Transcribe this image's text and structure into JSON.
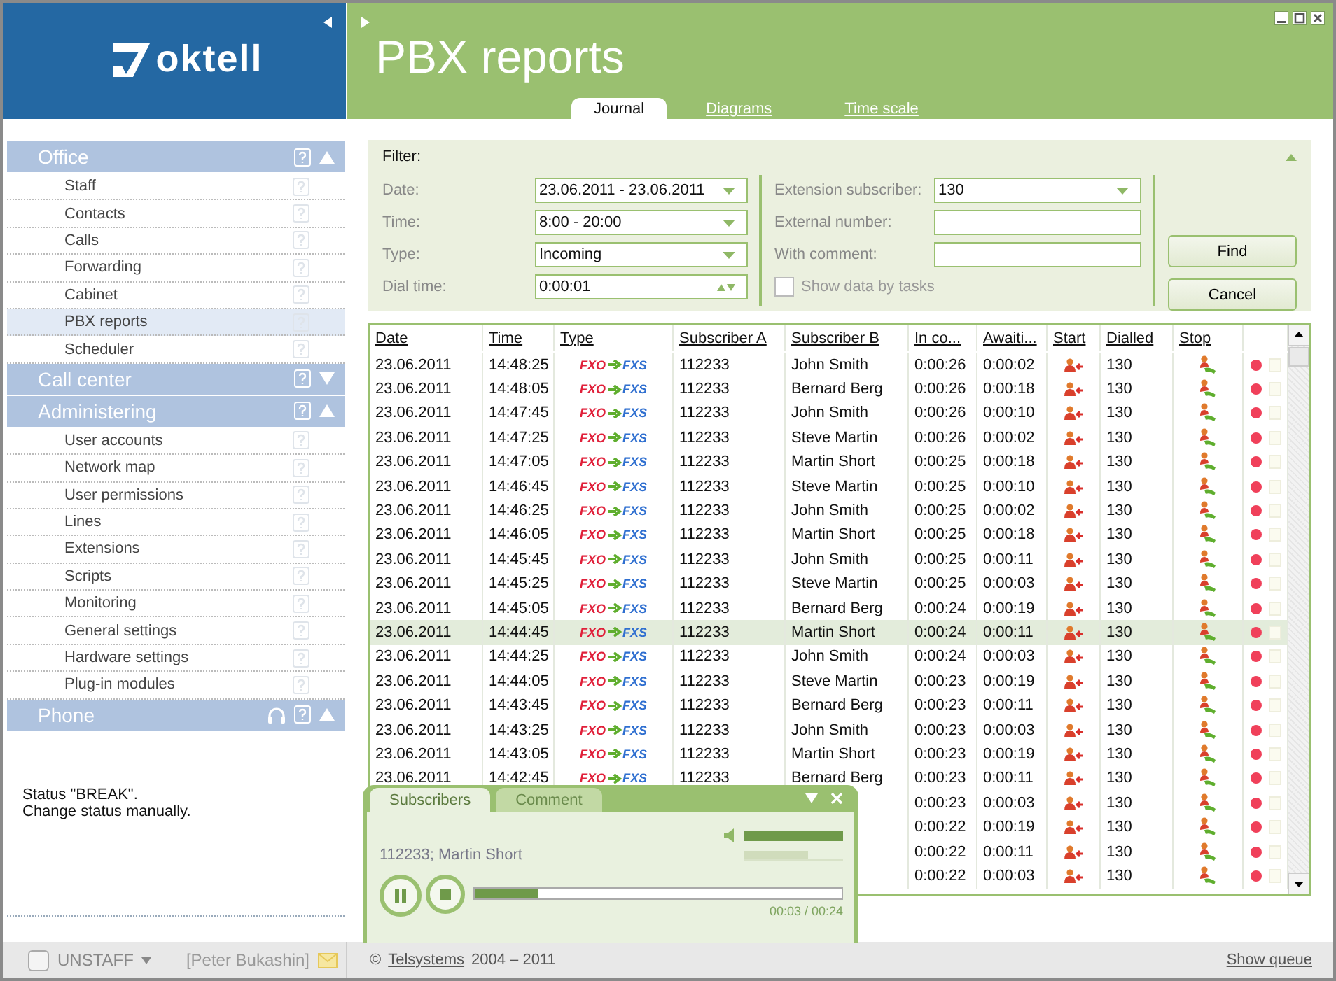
{
  "logo": {
    "text": "oktell"
  },
  "header": {
    "title": "PBX reports",
    "tabs": [
      {
        "label": "Journal",
        "selected": true
      },
      {
        "label": "Diagrams",
        "selected": false
      },
      {
        "label": "Time scale",
        "selected": false
      }
    ]
  },
  "sidebar": {
    "sections": [
      {
        "title": "Office",
        "expanded": true,
        "headset": false,
        "items": [
          {
            "label": "Staff",
            "selected": false
          },
          {
            "label": "Contacts",
            "selected": false
          },
          {
            "label": "Calls",
            "selected": false
          },
          {
            "label": "Forwarding",
            "selected": false
          },
          {
            "label": "Cabinet",
            "selected": false
          },
          {
            "label": "PBX reports",
            "selected": true
          },
          {
            "label": "Scheduler",
            "selected": false
          }
        ]
      },
      {
        "title": "Call center",
        "expanded": false,
        "headset": false
      },
      {
        "title": "Administering",
        "expanded": true,
        "headset": false,
        "items": [
          {
            "label": "User accounts",
            "selected": false
          },
          {
            "label": "Network map",
            "selected": false
          },
          {
            "label": "User permissions",
            "selected": false
          },
          {
            "label": "Lines",
            "selected": false
          },
          {
            "label": "Extensions",
            "selected": false
          },
          {
            "label": "Scripts",
            "selected": false
          },
          {
            "label": "Monitoring",
            "selected": false
          },
          {
            "label": "General settings",
            "selected": false
          },
          {
            "label": "Hardware settings",
            "selected": false
          },
          {
            "label": "Plug-in modules",
            "selected": false
          }
        ]
      },
      {
        "title": "Phone",
        "expanded": true,
        "headset": true
      }
    ]
  },
  "status_message": [
    "Status \"BREAK\".",
    "Change status manually."
  ],
  "status_bar": {
    "checked": false,
    "status": "UNSTAFF",
    "user": "[Peter Bukashin]"
  },
  "filter": {
    "title": "Filter:",
    "left": [
      {
        "label": "Date:",
        "kind": "dropdown",
        "value": "23.06.2011 - 23.06.2011"
      },
      {
        "label": "Time:",
        "kind": "dropdown",
        "value": "8:00 - 20:00"
      },
      {
        "label": "Type:",
        "kind": "dropdown",
        "value": "Incoming"
      },
      {
        "label": "Dial time:",
        "kind": "spinner",
        "value": "0:00:01"
      }
    ],
    "right": [
      {
        "label": "Extension subscriber:",
        "kind": "dropdown",
        "value": "130"
      },
      {
        "label": "External number:",
        "kind": "text"
      },
      {
        "label": "With comment:",
        "kind": "text"
      }
    ],
    "checkbox": {
      "label": "Show data by tasks",
      "checked": false
    },
    "buttons": [
      "Find",
      "Cancel"
    ]
  },
  "table": {
    "columns": [
      "Date",
      "Time",
      "Type",
      "Subscriber A",
      "Subscriber B",
      "In co...",
      "Awaiti...",
      "Start",
      "Dialled",
      "Stop"
    ],
    "rows": [
      {
        "date": "23.06.2011",
        "time": "14:48:25",
        "type": {
          "from": "FXO",
          "to": "FXS"
        },
        "subscriber_a": "112233",
        "subscriber_b": "John Smith",
        "in_call": "0:00:26",
        "waiting": "0:00:02",
        "dialled": "130",
        "selected": false
      },
      {
        "date": "23.06.2011",
        "time": "14:48:05",
        "type": {
          "from": "FXO",
          "to": "FXS"
        },
        "subscriber_a": "112233",
        "subscriber_b": "Bernard Berg",
        "in_call": "0:00:26",
        "waiting": "0:00:18",
        "dialled": "130",
        "selected": false
      },
      {
        "date": "23.06.2011",
        "time": "14:47:45",
        "type": {
          "from": "FXO",
          "to": "FXS"
        },
        "subscriber_a": "112233",
        "subscriber_b": "John Smith",
        "in_call": "0:00:26",
        "waiting": "0:00:10",
        "dialled": "130",
        "selected": false
      },
      {
        "date": "23.06.2011",
        "time": "14:47:25",
        "type": {
          "from": "FXO",
          "to": "FXS"
        },
        "subscriber_a": "112233",
        "subscriber_b": "Steve Martin",
        "in_call": "0:00:26",
        "waiting": "0:00:02",
        "dialled": "130",
        "selected": false
      },
      {
        "date": "23.06.2011",
        "time": "14:47:05",
        "type": {
          "from": "FXO",
          "to": "FXS"
        },
        "subscriber_a": "112233",
        "subscriber_b": "Martin Short",
        "in_call": "0:00:25",
        "waiting": "0:00:18",
        "dialled": "130",
        "selected": false
      },
      {
        "date": "23.06.2011",
        "time": "14:46:45",
        "type": {
          "from": "FXO",
          "to": "FXS"
        },
        "subscriber_a": "112233",
        "subscriber_b": "Steve Martin",
        "in_call": "0:00:25",
        "waiting": "0:00:10",
        "dialled": "130",
        "selected": false
      },
      {
        "date": "23.06.2011",
        "time": "14:46:25",
        "type": {
          "from": "FXO",
          "to": "FXS"
        },
        "subscriber_a": "112233",
        "subscriber_b": "John Smith",
        "in_call": "0:00:25",
        "waiting": "0:00:02",
        "dialled": "130",
        "selected": false
      },
      {
        "date": "23.06.2011",
        "time": "14:46:05",
        "type": {
          "from": "FXO",
          "to": "FXS"
        },
        "subscriber_a": "112233",
        "subscriber_b": "Martin Short",
        "in_call": "0:00:25",
        "waiting": "0:00:18",
        "dialled": "130",
        "selected": false
      },
      {
        "date": "23.06.2011",
        "time": "14:45:45",
        "type": {
          "from": "FXO",
          "to": "FXS"
        },
        "subscriber_a": "112233",
        "subscriber_b": "John Smith",
        "in_call": "0:00:25",
        "waiting": "0:00:11",
        "dialled": "130",
        "selected": false
      },
      {
        "date": "23.06.2011",
        "time": "14:45:25",
        "type": {
          "from": "FXO",
          "to": "FXS"
        },
        "subscriber_a": "112233",
        "subscriber_b": "Steve Martin",
        "in_call": "0:00:25",
        "waiting": "0:00:03",
        "dialled": "130",
        "selected": false
      },
      {
        "date": "23.06.2011",
        "time": "14:45:05",
        "type": {
          "from": "FXO",
          "to": "FXS"
        },
        "subscriber_a": "112233",
        "subscriber_b": "Bernard Berg",
        "in_call": "0:00:24",
        "waiting": "0:00:19",
        "dialled": "130",
        "selected": false
      },
      {
        "date": "23.06.2011",
        "time": "14:44:45",
        "type": {
          "from": "FXO",
          "to": "FXS"
        },
        "subscriber_a": "112233",
        "subscriber_b": "Martin Short",
        "in_call": "0:00:24",
        "waiting": "0:00:11",
        "dialled": "130",
        "selected": true
      },
      {
        "date": "23.06.2011",
        "time": "14:44:25",
        "type": {
          "from": "FXO",
          "to": "FXS"
        },
        "subscriber_a": "112233",
        "subscriber_b": "John Smith",
        "in_call": "0:00:24",
        "waiting": "0:00:03",
        "dialled": "130",
        "selected": false
      },
      {
        "date": "23.06.2011",
        "time": "14:44:05",
        "type": {
          "from": "FXO",
          "to": "FXS"
        },
        "subscriber_a": "112233",
        "subscriber_b": "Steve Martin",
        "in_call": "0:00:23",
        "waiting": "0:00:19",
        "dialled": "130",
        "selected": false
      },
      {
        "date": "23.06.2011",
        "time": "14:43:45",
        "type": {
          "from": "FXO",
          "to": "FXS"
        },
        "subscriber_a": "112233",
        "subscriber_b": "Bernard Berg",
        "in_call": "0:00:23",
        "waiting": "0:00:11",
        "dialled": "130",
        "selected": false
      },
      {
        "date": "23.06.2011",
        "time": "14:43:25",
        "type": {
          "from": "FXO",
          "to": "FXS"
        },
        "subscriber_a": "112233",
        "subscriber_b": "John Smith",
        "in_call": "0:00:23",
        "waiting": "0:00:03",
        "dialled": "130",
        "selected": false
      },
      {
        "date": "23.06.2011",
        "time": "14:43:05",
        "type": {
          "from": "FXO",
          "to": "FXS"
        },
        "subscriber_a": "112233",
        "subscriber_b": "Martin Short",
        "in_call": "0:00:23",
        "waiting": "0:00:19",
        "dialled": "130",
        "selected": false
      },
      {
        "date": "23.06.2011",
        "time": "14:42:45",
        "type": {
          "from": "FXO",
          "to": "FXS"
        },
        "subscriber_a": "112233",
        "subscriber_b": "Bernard Berg",
        "in_call": "0:00:23",
        "waiting": "0:00:11",
        "dialled": "130",
        "selected": false
      },
      {
        "in_call": "0:00:23",
        "waiting": "0:00:03",
        "dialled": "130",
        "selected": false
      },
      {
        "in_call": "0:00:22",
        "waiting": "0:00:19",
        "dialled": "130",
        "selected": false
      },
      {
        "in_call": "0:00:22",
        "waiting": "0:00:11",
        "dialled": "130",
        "selected": false
      },
      {
        "in_call": "0:00:22",
        "waiting": "0:00:03",
        "dialled": "130",
        "selected": false
      }
    ]
  },
  "player": {
    "tabs": [
      {
        "label": "Subscribers",
        "selected": true
      },
      {
        "label": "Comment",
        "selected": false
      }
    ],
    "caller": "112233; Martin Short",
    "volume": {
      "level": 1
    },
    "slider": {
      "level": 0.65
    },
    "playing": true,
    "progress": {
      "level": 0.17
    },
    "time": "00:03 / 00:24"
  },
  "footer": {
    "copyright": "©",
    "company": "Telsystems",
    "years": "2004 – 2011",
    "link": "Show queue"
  }
}
